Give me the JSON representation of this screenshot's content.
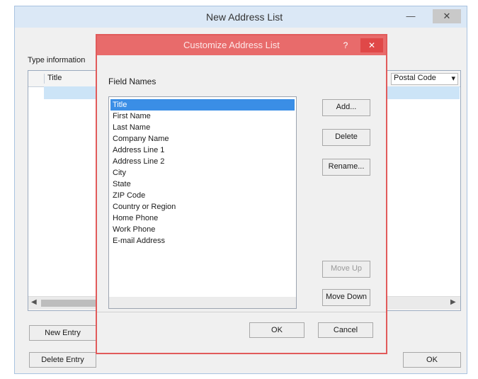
{
  "outer_window": {
    "title": "New Address List",
    "min_glyph": "—",
    "close_glyph": "✕",
    "type_label": "Type information",
    "grid": {
      "col_title": "Title",
      "col_postal": "Postal Code",
      "postal_dropdown_glyph": "▾"
    },
    "buttons": {
      "new_entry": "New Entry",
      "delete_entry": "Delete Entry",
      "ok": "OK"
    }
  },
  "dialog": {
    "title": "Customize Address List",
    "help_glyph": "?",
    "close_glyph": "✕",
    "fields_label": "Field Names",
    "fields": [
      "Title",
      "First Name",
      "Last Name",
      "Company Name",
      "Address Line 1",
      "Address Line 2",
      "City",
      "State",
      "ZIP Code",
      "Country or Region",
      "Home Phone",
      "Work Phone",
      "E-mail Address"
    ],
    "selected_index": 0,
    "buttons": {
      "add": "Add...",
      "delete": "Delete",
      "rename": "Rename...",
      "move_up": "Move Up",
      "move_down": "Move Down",
      "ok": "OK",
      "cancel": "Cancel"
    }
  },
  "colors": {
    "dialog_accent": "#e15b5b",
    "selection": "#3a8ee6"
  }
}
